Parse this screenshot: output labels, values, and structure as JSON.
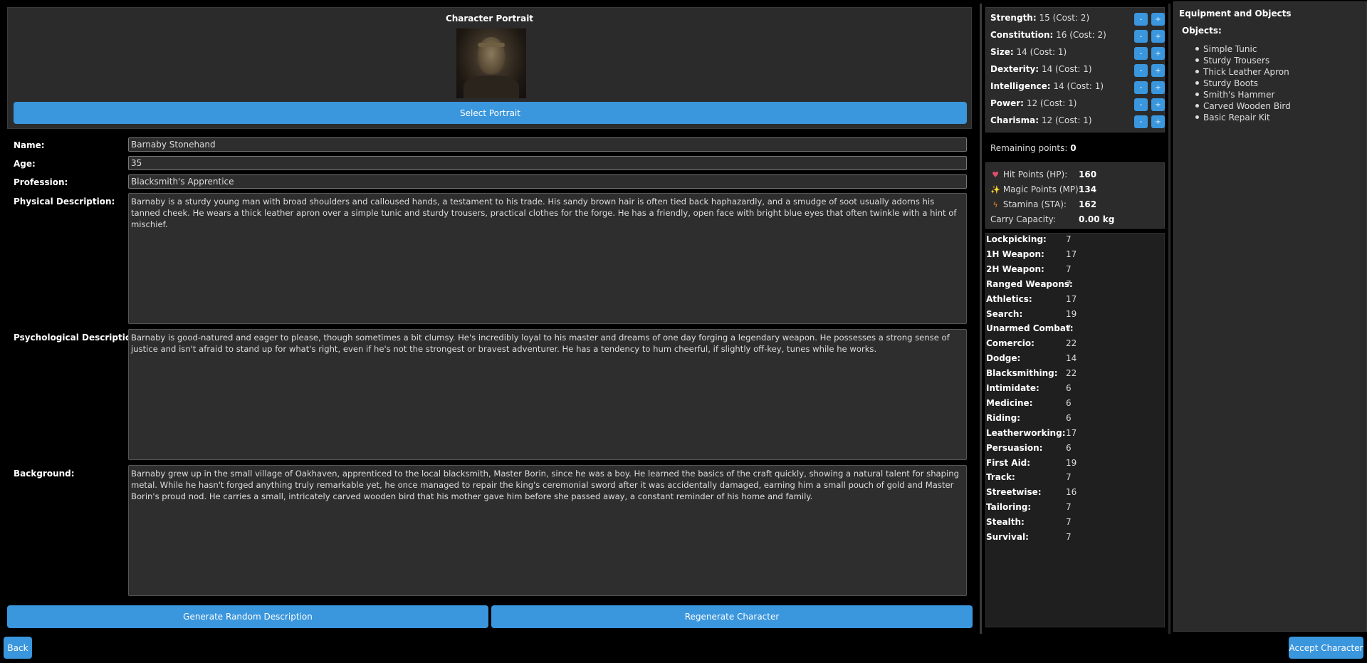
{
  "portrait": {
    "title": "Character Portrait",
    "select_label": "Select Portrait"
  },
  "fields": {
    "name_label": "Name:",
    "name_value": "Barnaby Stonehand",
    "age_label": "Age:",
    "age_value": "35",
    "profession_label": "Profession:",
    "profession_value": "Blacksmith's Apprentice",
    "physical_label": "Physical Description:",
    "physical_value": "Barnaby is a sturdy young man with broad shoulders and calloused hands, a testament to his trade. His sandy brown hair is often tied back haphazardly, and a smudge of soot usually adorns his tanned cheek. He wears a thick leather apron over a simple tunic and sturdy trousers, practical clothes for the forge. He has a friendly, open face with bright blue eyes that often twinkle with a hint of mischief.",
    "psych_label": "Psychological Description:",
    "psych_value": "Barnaby is good-natured and eager to please, though sometimes a bit clumsy. He's incredibly loyal to his master and dreams of one day forging a legendary weapon. He possesses a strong sense of justice and isn't afraid to stand up for what's right, even if he's not the strongest or bravest adventurer. He has a tendency to hum cheerful, if slightly off-key, tunes while he works.",
    "background_label": "Background:",
    "background_value": "Barnaby grew up in the small village of Oakhaven, apprenticed to the local blacksmith, Master Borin, since he was a boy. He learned the basics of the craft quickly, showing a natural talent for shaping metal. While he hasn't forged anything truly remarkable yet, he once managed to repair the king's ceremonial sword after it was accidentally damaged, earning him a small pouch of gold and Master Borin's proud nod. He carries a small, intricately carved wooden bird that his mother gave him before she passed away, a constant reminder of his home and family."
  },
  "buttons": {
    "generate_desc": "Generate Random Description",
    "regenerate": "Regenerate Character",
    "back": "Back",
    "accept": "Accept Character",
    "minus": "-",
    "plus": "+"
  },
  "attributes": [
    {
      "name": "Strength:",
      "value": "15",
      "cost": "(Cost: 2)"
    },
    {
      "name": "Constitution:",
      "value": "16",
      "cost": "(Cost: 2)"
    },
    {
      "name": "Size:",
      "value": "14",
      "cost": "(Cost: 1)"
    },
    {
      "name": "Dexterity:",
      "value": "14",
      "cost": "(Cost: 1)"
    },
    {
      "name": "Intelligence:",
      "value": "14",
      "cost": "(Cost: 1)"
    },
    {
      "name": "Power:",
      "value": "12",
      "cost": "(Cost: 1)"
    },
    {
      "name": "Charisma:",
      "value": "12",
      "cost": "(Cost: 1)"
    }
  ],
  "remaining": {
    "label": "Remaining points:",
    "value": "0"
  },
  "stats": {
    "hp_label": "Hit Points (HP):",
    "hp_value": "160",
    "hp_icon": "heart-icon",
    "mp_label": "Magic Points (MP):",
    "mp_value": "134",
    "mp_icon": "sparkles-icon",
    "sta_label": "Stamina (STA):",
    "sta_value": "162",
    "sta_icon": "lightning-icon",
    "carry_label": "Carry Capacity:",
    "carry_value": "0.00 kg"
  },
  "skills": [
    {
      "name": "Lockpicking:",
      "value": "7"
    },
    {
      "name": "1H Weapon:",
      "value": "17"
    },
    {
      "name": "2H Weapon:",
      "value": "7"
    },
    {
      "name": "Ranged Weapons:",
      "value": "7"
    },
    {
      "name": "Athletics:",
      "value": "17"
    },
    {
      "name": "Search:",
      "value": "19"
    },
    {
      "name": "Unarmed Combat:",
      "value": "7"
    },
    {
      "name": "Comercio:",
      "value": "22"
    },
    {
      "name": "Dodge:",
      "value": "14"
    },
    {
      "name": "Blacksmithing:",
      "value": "22"
    },
    {
      "name": "Intimidate:",
      "value": "6"
    },
    {
      "name": "Medicine:",
      "value": "6"
    },
    {
      "name": "Riding:",
      "value": "6"
    },
    {
      "name": "Leatherworking:",
      "value": "17"
    },
    {
      "name": "Persuasion:",
      "value": "6"
    },
    {
      "name": "First Aid:",
      "value": "19"
    },
    {
      "name": "Track:",
      "value": "7"
    },
    {
      "name": "Streetwise:",
      "value": "16"
    },
    {
      "name": "Tailoring:",
      "value": "7"
    },
    {
      "name": "Stealth:",
      "value": "7"
    },
    {
      "name": "Survival:",
      "value": "7"
    }
  ],
  "equipment": {
    "title": "Equipment and Objects",
    "objects_label": "Objects:",
    "items": [
      "Simple Tunic",
      "Sturdy Trousers",
      "Thick Leather Apron",
      "Sturdy Boots",
      "Smith's Hammer",
      "Carved Wooden Bird",
      "Basic Repair Kit"
    ]
  },
  "colors": {
    "accent": "#3a96dd",
    "panel": "#2b2b2b",
    "background": "#000000"
  }
}
